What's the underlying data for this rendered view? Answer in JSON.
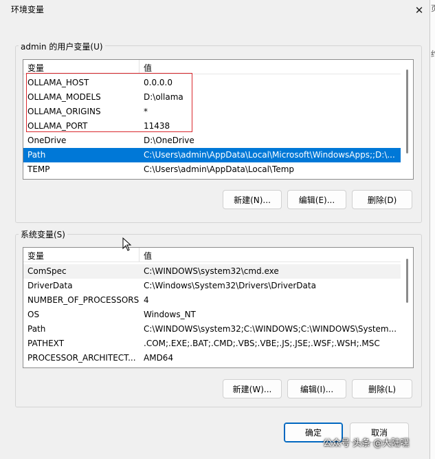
{
  "window": {
    "title": "环境变量",
    "close_glyph": "✕"
  },
  "user_vars": {
    "label": "admin 的用户变量(U)",
    "columns": {
      "name": "变量",
      "value": "值"
    },
    "rows": [
      {
        "name": "OLLAMA_HOST",
        "value": "0.0.0.0"
      },
      {
        "name": "OLLAMA_MODELS",
        "value": "D:\\ollama"
      },
      {
        "name": "OLLAMA_ORIGINS",
        "value": "*"
      },
      {
        "name": "OLLAMA_PORT",
        "value": "11438"
      },
      {
        "name": "OneDrive",
        "value": "D:\\OneDrive"
      },
      {
        "name": "Path",
        "value": "C:\\Users\\admin\\AppData\\Local\\Microsoft\\WindowsApps;;D:\\..."
      },
      {
        "name": "TEMP",
        "value": "C:\\Users\\admin\\AppData\\Local\\Temp"
      }
    ],
    "selected_index": 5,
    "buttons": {
      "new": "新建(N)...",
      "edit": "编辑(E)...",
      "delete": "删除(D)"
    }
  },
  "system_vars": {
    "label": "系统变量(S)",
    "columns": {
      "name": "变量",
      "value": "值"
    },
    "rows": [
      {
        "name": "ComSpec",
        "value": "C:\\WINDOWS\\system32\\cmd.exe"
      },
      {
        "name": "DriverData",
        "value": "C:\\Windows\\System32\\Drivers\\DriverData"
      },
      {
        "name": "NUMBER_OF_PROCESSORS",
        "value": "4"
      },
      {
        "name": "OS",
        "value": "Windows_NT"
      },
      {
        "name": "Path",
        "value": "C:\\WINDOWS\\system32;C:\\WINDOWS;C:\\WINDOWS\\System..."
      },
      {
        "name": "PATHEXT",
        "value": ".COM;.EXE;.BAT;.CMD;.VBS;.VBE;.JS;.JSE;.WSF;.WSH;.MSC"
      },
      {
        "name": "PROCESSOR_ARCHITECT...",
        "value": "AMD64"
      }
    ],
    "buttons": {
      "new": "新建(W)...",
      "edit": "编辑(I)...",
      "delete": "删除(L)"
    }
  },
  "footer": {
    "ok": "确定",
    "cancel": "取消"
  },
  "watermark": "公众号 头条 @大陆嘿",
  "edge_text": [
    "页",
    "约"
  ],
  "colors": {
    "selection": "#0078d7",
    "highlight_box": "#d9262c",
    "primary_border": "#0067c0"
  }
}
